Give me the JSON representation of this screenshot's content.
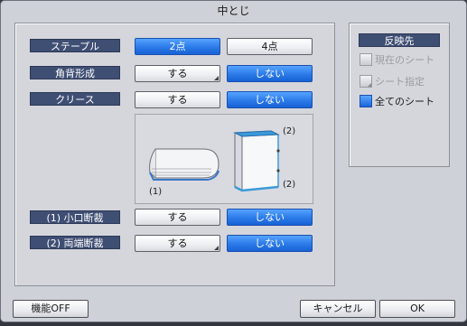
{
  "window": {
    "title": "中とじ"
  },
  "rows": [
    {
      "label": "ステープル",
      "options": [
        "2点",
        "4点"
      ],
      "selected": 0,
      "has_submenu": [
        false,
        false
      ]
    },
    {
      "label": "角背形成",
      "options": [
        "する",
        "しない"
      ],
      "selected": 1,
      "has_submenu": [
        true,
        false
      ]
    },
    {
      "label": "クリース",
      "options": [
        "する",
        "しない"
      ],
      "selected": 1,
      "has_submenu": [
        false,
        false
      ]
    },
    {
      "label": "(1) 小口断裁",
      "options": [
        "する",
        "しない"
      ],
      "selected": 1,
      "has_submenu": [
        false,
        false
      ]
    },
    {
      "label": "(2) 両端断裁",
      "options": [
        "する",
        "しない"
      ],
      "selected": 1,
      "has_submenu": [
        true,
        false
      ]
    }
  ],
  "illustration": {
    "label_left": "(1)",
    "label_top": "(2)",
    "label_bottom": "(2)"
  },
  "apply": {
    "title": "反映先",
    "options": [
      {
        "label": "現在のシート",
        "enabled": false,
        "checked": false
      },
      {
        "label": "シート指定",
        "enabled": false,
        "checked": false
      },
      {
        "label": "全てのシート",
        "enabled": true,
        "checked": true
      }
    ]
  },
  "footer": {
    "off_label": "機能OFF",
    "cancel_label": "キャンセル",
    "ok_label": "OK"
  },
  "colors": {
    "selected_blue": "#2b7ae8",
    "label_navy": "#3f4e73",
    "dialog_gray": "#cfd1d8"
  }
}
